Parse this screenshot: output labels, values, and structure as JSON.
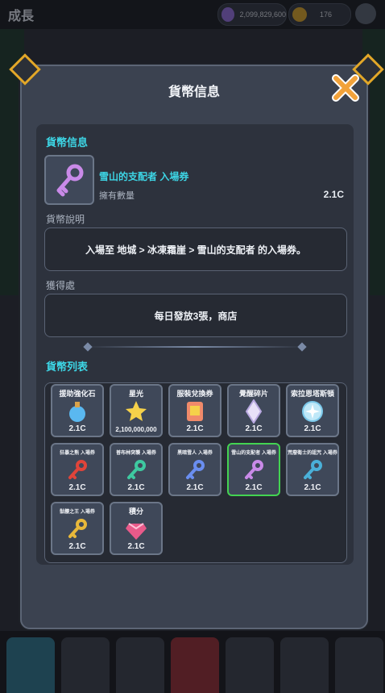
{
  "background": {
    "title": "成長",
    "gems": "2,099,829,600",
    "coins": "176"
  },
  "modal": {
    "title": "貨幣信息",
    "section_info": "貨幣信息",
    "currency_name": "雪山的支配者 入場券",
    "owned_label": "擁有數量",
    "owned_amount": "2.1C",
    "desc_label": "貨幣說明",
    "description": "入場至 地城 > 冰凍霜崖 > 雪山的支配者 的入場券。",
    "obtain_label": "獲得處",
    "obtain_text": "每日發放3張，商店",
    "list_label": "貨幣列表",
    "items": [
      {
        "name": "援助強化石",
        "amount": "2.1C"
      },
      {
        "name": "星光",
        "amount": "2,100,000,000"
      },
      {
        "name": "服裝兌換券",
        "amount": "2.1C"
      },
      {
        "name": "覺醒碎片",
        "amount": "2.1C"
      },
      {
        "name": "索拉恩塔斯頓",
        "amount": "2.1C"
      },
      {
        "name": "狂暴之熊 入場券",
        "amount": "2.1C"
      },
      {
        "name": "普布林突襲 入場券",
        "amount": "2.1C"
      },
      {
        "name": "黑暗雪人 入場券",
        "amount": "2.1C"
      },
      {
        "name": "雪山的支配者 入場券",
        "amount": "2.1C"
      },
      {
        "name": "荒廢衛士的詛咒 入場券",
        "amount": "2.1C"
      },
      {
        "name": "骷髏之王 入場券",
        "amount": "2.1C"
      },
      {
        "name": "積分",
        "amount": "2.1C"
      }
    ]
  },
  "colors": {
    "accent": "#3dd6e6",
    "selected": "#43d352",
    "close": "#f2a23a"
  }
}
